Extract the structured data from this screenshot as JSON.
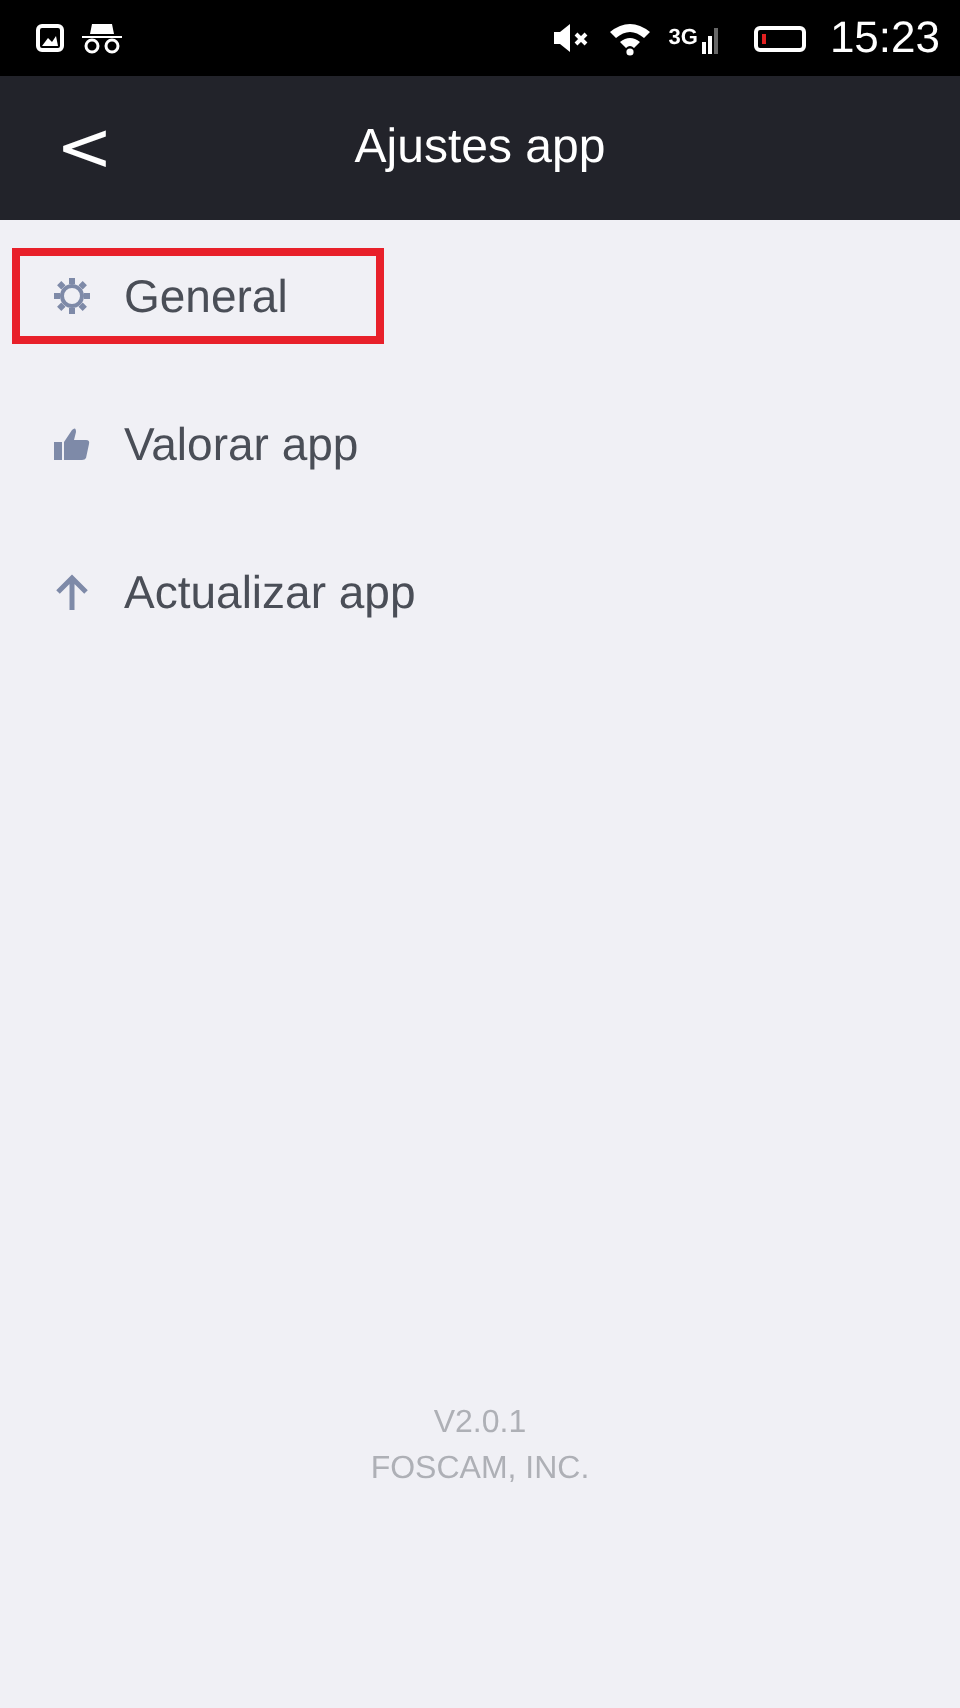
{
  "status_bar": {
    "network": "3G",
    "time": "15:23"
  },
  "header": {
    "back": "<",
    "title": "Ajustes app"
  },
  "items": [
    {
      "kind": "gear",
      "label": "General",
      "highlighted": true
    },
    {
      "kind": "thumb",
      "label": "Valorar app",
      "highlighted": false
    },
    {
      "kind": "arrow",
      "label": "Actualizar app",
      "highlighted": false
    }
  ],
  "footer": {
    "version": "V2.0.1",
    "company": "FOSCAM, INC."
  }
}
